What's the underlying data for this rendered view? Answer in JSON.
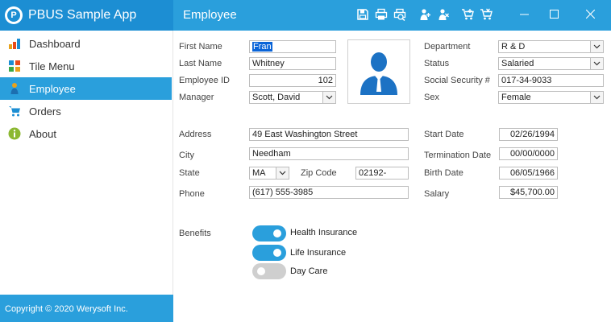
{
  "app": {
    "title": "PBUS Sample App",
    "logo_letter": "P"
  },
  "header": {
    "page_title": "Employee",
    "toolbar_icons": [
      "save-icon",
      "print-icon",
      "print-preview-icon",
      "add-user-icon",
      "delete-user-icon",
      "add-to-cart-icon",
      "remove-from-cart-icon"
    ],
    "window_controls": [
      "minimize-icon",
      "maximize-icon",
      "close-icon"
    ]
  },
  "sidebar": {
    "items": [
      {
        "label": "Dashboard",
        "icon": "chart-icon",
        "active": false
      },
      {
        "label": "Tile Menu",
        "icon": "tiles-icon",
        "active": false
      },
      {
        "label": "Employee",
        "icon": "person-icon",
        "active": true
      },
      {
        "label": "Orders",
        "icon": "cart-icon",
        "active": false
      },
      {
        "label": "About",
        "icon": "info-icon",
        "active": false
      }
    ],
    "copyright": "Copyright © 2020 Werysoft Inc."
  },
  "form": {
    "first_name": {
      "label": "First Name",
      "value": "Fran"
    },
    "last_name": {
      "label": "Last Name",
      "value": "Whitney"
    },
    "employee_id": {
      "label": "Employee ID",
      "value": "102"
    },
    "manager": {
      "label": "Manager",
      "value": "Scott, David"
    },
    "department": {
      "label": "Department",
      "value": "R & D"
    },
    "status": {
      "label": "Status",
      "value": "Salaried"
    },
    "ssn": {
      "label": "Social Security #",
      "value": "017-34-9033"
    },
    "sex": {
      "label": "Sex",
      "value": "Female"
    },
    "address": {
      "label": "Address",
      "value": "49 East Washington Street"
    },
    "city": {
      "label": "City",
      "value": "Needham"
    },
    "state": {
      "label": "State",
      "value": "MA"
    },
    "zip": {
      "label": "Zip Code",
      "value": "02192-"
    },
    "phone": {
      "label": "Phone",
      "value": "(617) 555-3985"
    },
    "start_date": {
      "label": "Start Date",
      "value": "02/26/1994"
    },
    "termination_date": {
      "label": "Termination Date",
      "value": "00/00/0000"
    },
    "birth_date": {
      "label": "Birth Date",
      "value": "06/05/1966"
    },
    "salary": {
      "label": "Salary",
      "value": "$45,700.00"
    }
  },
  "benefits": {
    "label": "Benefits",
    "items": [
      {
        "label": "Health Insurance",
        "enabled": true
      },
      {
        "label": "Life Insurance",
        "enabled": true
      },
      {
        "label": "Day Care",
        "enabled": false
      }
    ]
  },
  "colors": {
    "accent": "#2a9fdc",
    "accent_dark": "#1c8ed3",
    "selection": "#0a64d8"
  }
}
